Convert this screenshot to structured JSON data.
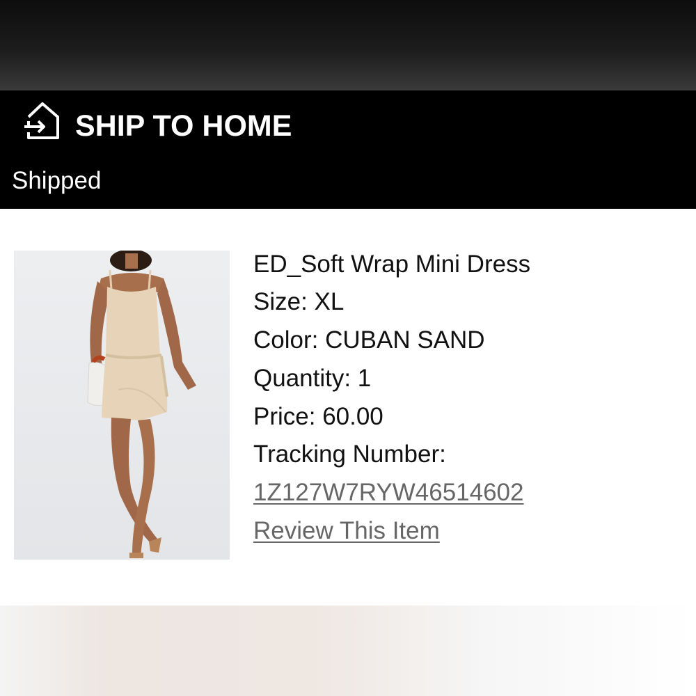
{
  "header": {
    "title": "SHIP TO HOME",
    "icon": "home-arrow-icon",
    "status": "Shipped"
  },
  "item": {
    "name": "ED_Soft Wrap Mini Dress",
    "size": "Size: XL",
    "color": "Color: CUBAN SAND",
    "quantity": "Quantity: 1",
    "price": "Price: 60.00",
    "tracking_label": "Tracking Number:",
    "tracking_number": "1Z127W7RYW46514602",
    "review_link": "Review This Item",
    "image_icon": "product-photo"
  },
  "colors": {
    "header_bg": "#000000",
    "link": "#666666",
    "dress": "#e6d3b8"
  }
}
